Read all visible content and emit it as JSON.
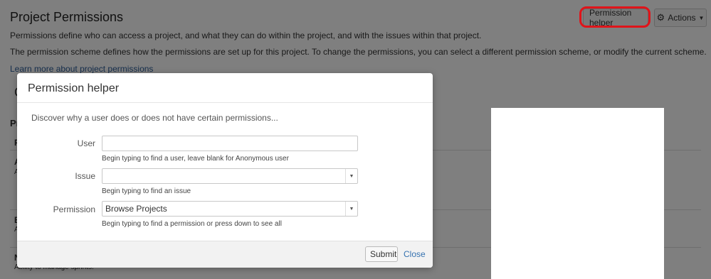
{
  "page": {
    "title": "Project Permissions",
    "description_1": "Permissions define who can access a project, and what they can do within the project, and with the issues within that project.",
    "description_2": "The permission scheme defines how the permissions are set up for this project. To change the permissions, you can select a different permission scheme, or modify the current scheme.",
    "learn_more_link": "Learn more about project permissions",
    "background_fragments": [
      "C",
      "Pr",
      "P",
      "A",
      "A",
      "B",
      "A",
      "N",
      "Ability to manage sprints."
    ]
  },
  "toolbar": {
    "permission_helper_label": "Permission helper",
    "actions_label": "Actions",
    "actions_icon": "gear-icon"
  },
  "dialog": {
    "title": "Permission helper",
    "intro": "Discover why a user does or does not have certain permissions...",
    "user": {
      "label": "User",
      "value": "",
      "hint": "Begin typing to find a user, leave blank for Anonymous user"
    },
    "issue": {
      "label": "Issue",
      "value": "",
      "hint": "Begin typing to find an issue"
    },
    "permission": {
      "label": "Permission",
      "value": "Browse Projects",
      "hint": "Begin typing to find a permission or press down to see all"
    },
    "submit_label": "Submit",
    "close_label": "Close"
  },
  "colors": {
    "highlight": "#e0141a",
    "link": "#3572b0",
    "overlay": "rgba(0,0,0,0.5)"
  }
}
